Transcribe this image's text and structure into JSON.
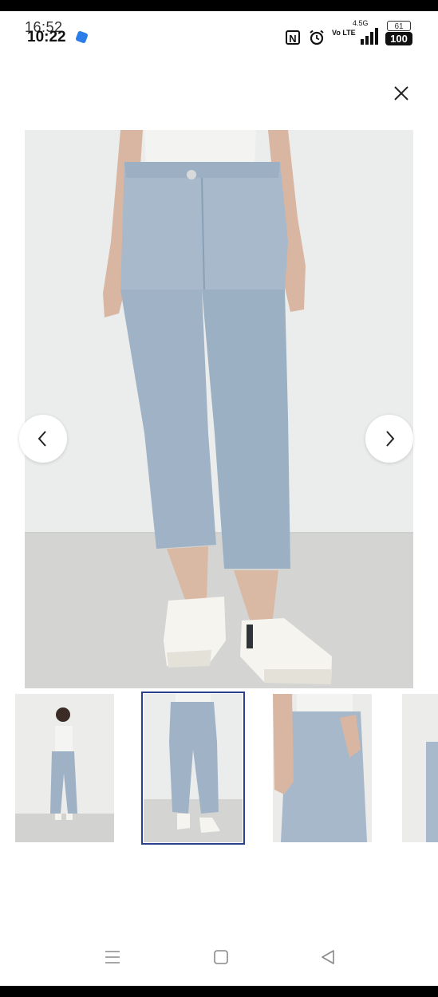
{
  "status_bar": {
    "time_primary": "10:22",
    "time_secondary": "16:52",
    "network_label": "4.5G",
    "volte_label": "Vo LTE",
    "battery_primary": "100",
    "battery_secondary": "61",
    "icons": [
      "app-icon",
      "nfc-icon",
      "alarm-icon",
      "volte-icon",
      "signal-icon",
      "battery-icon"
    ]
  },
  "viewer": {
    "close_icon": "close-icon",
    "prev_icon": "chevron-left-icon",
    "next_icon": "chevron-right-icon",
    "selected_index": 1,
    "thumbnail_count_visible": 4
  },
  "system_nav": {
    "icons": [
      "menu-icon",
      "home-icon",
      "back-icon"
    ]
  },
  "colors": {
    "selection_outline": "#2b3f8f",
    "denim": "#9cb0c4",
    "background": "#e9eae9",
    "floor": "#d3d4d2"
  }
}
